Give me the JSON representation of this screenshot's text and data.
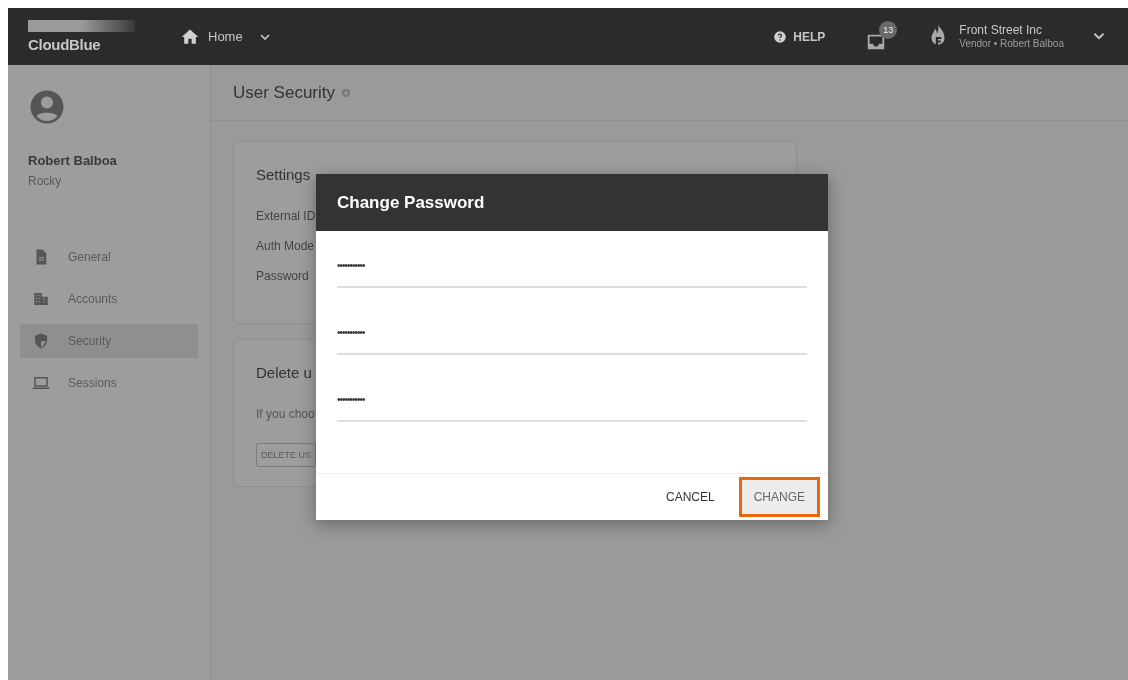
{
  "header": {
    "logo": "CloudBlue",
    "nav": {
      "label": "Home"
    },
    "help": "HELP",
    "inbox_badge": "13",
    "account": {
      "name": "Front Street Inc",
      "subtitle": "Vendor • Robert Balboa"
    }
  },
  "sidebar": {
    "user": {
      "name": "Robert Balboa",
      "nickname": "Rocky"
    },
    "items": [
      {
        "label": "General",
        "selected": false
      },
      {
        "label": "Accounts",
        "selected": false
      },
      {
        "label": "Security",
        "selected": true
      },
      {
        "label": "Sessions",
        "selected": false
      }
    ]
  },
  "page": {
    "title": "User Security",
    "settings_card": {
      "title": "Settings",
      "rows": [
        "External ID",
        "Auth Mode",
        "Password"
      ]
    },
    "delete_card": {
      "title": "Delete u",
      "text": "If you choo",
      "button": "DELETE US"
    }
  },
  "dialog": {
    "title": "Change Password",
    "fields": [
      {
        "value": "•••••••••••"
      },
      {
        "value": "•••••••••••"
      },
      {
        "value": "•••••••••••"
      }
    ],
    "buttons": [
      {
        "label": "CANCEL",
        "kind": "flat",
        "highlighted": false
      },
      {
        "label": "CHANGE",
        "kind": "raised",
        "highlighted": true
      }
    ]
  }
}
